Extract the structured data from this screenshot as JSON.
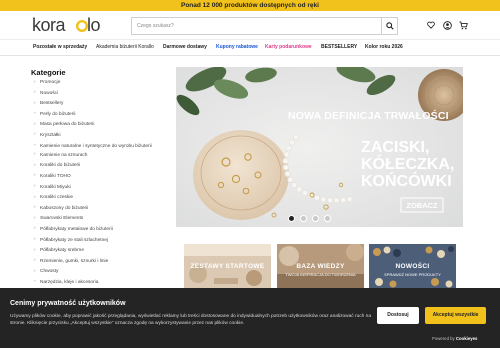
{
  "topbar": {
    "text": "Ponad 12 000 produktów dostępnych od ręki"
  },
  "header": {
    "logo_text": "korallo",
    "search_placeholder": "Czego szukasz?",
    "icons": [
      "search-icon",
      "heart-icon",
      "user-icon",
      "cart-icon"
    ]
  },
  "nav": {
    "items": [
      {
        "label": "Pozostałe w sprzedaży",
        "bold": true,
        "color": "#222222"
      },
      {
        "label": "Akademia biżuterii Korallo",
        "bold": false,
        "color": "#222222"
      },
      {
        "label": "Darmowe dostawy",
        "bold": true,
        "color": "#222222"
      },
      {
        "label": "Kupony rabatowe",
        "bold": true,
        "color": "#1a56d6"
      },
      {
        "label": "Karty podarunkowe",
        "bold": true,
        "color": "#e0398b"
      },
      {
        "label": "BESTSELLERY",
        "bold": true,
        "color": "#222222"
      },
      {
        "label": "Kolor roku 2026",
        "bold": true,
        "color": "#222222"
      }
    ]
  },
  "sidebar": {
    "title": "Kategorie",
    "items": [
      "Promocje",
      "Nowości",
      "Bestsellery",
      "Perły do biżuterii",
      "Masa perłowa do biżuterii",
      "Kryształki",
      "Kamienie naturalne i syntetyczne do wyrobu biżuterii",
      "Kamienie na sznurach",
      "Koraliki do biżuterii",
      "Koraliki TOHO",
      "Koraliki Miyuki",
      "Koraliki czeskie",
      "Kaboszony do biżuterii",
      "Swarovski Elements",
      "Półfabrykaty metalowe do biżuterii",
      "Półfabrykaty ze stali szlachetnej",
      "Półfabrykaty srebrne",
      "Rzemienie, gumki, sznurki i linie",
      "Chwosty",
      "Narzędzia, kleje i akcesoria"
    ]
  },
  "banner": {
    "headline": "NOWA DEFINICJA TRWAŁOŚCI",
    "lines": [
      "ZACISKI,",
      "KÓŁECZKA,",
      "KOŃCÓWKI"
    ],
    "cta": "ZOBACZ",
    "slides": 4,
    "active_slide": 1
  },
  "tiles": [
    {
      "label": "ZESTAWY STARTOWE",
      "sub": "",
      "bg": "#d9c6b0"
    },
    {
      "label": "BAZA WIEDZY",
      "sub": "TWOJA INSPIRACJA DO TWORZENIA",
      "bg": "#b89a7c"
    },
    {
      "label": "NOWOŚCI",
      "sub": "SPRAWDŹ NOWE PRODUKTY",
      "bg": "#51627a"
    }
  ],
  "cookie": {
    "title": "Cenimy prywatność użytkowników",
    "text": "Używamy plików cookie, aby poprawić jakość przeglądania, wyświetlać reklamy lub treści dostosowane do indywidualnych potrzeb użytkowników oraz analizować ruch na stronie. Kliknięcie przycisku „Akceptuj wszystkie” oznacza zgodę na wykorzystywanie przez nas plików cookie.",
    "decline": "Dostosuj",
    "accept": "Akceptuj wszystkie",
    "powered_prefix": "Powered by",
    "powered_brand": "Cookieyes"
  },
  "colors": {
    "accent": "#f1c21b",
    "dark": "#242424"
  }
}
